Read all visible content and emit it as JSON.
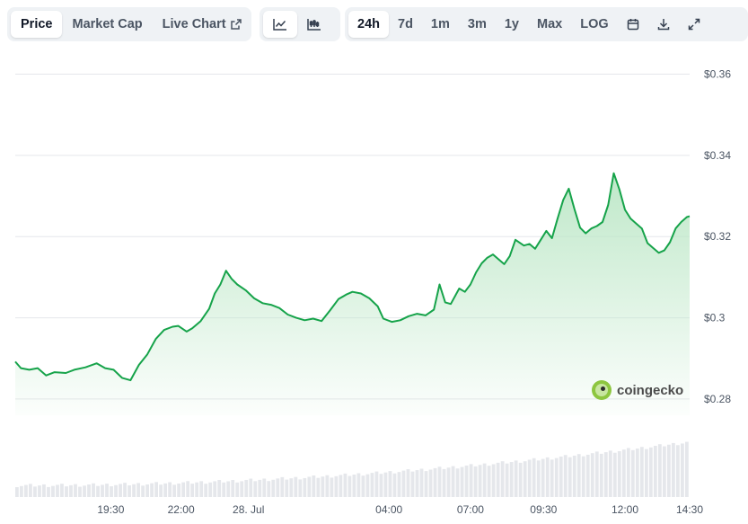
{
  "tabs": {
    "price": "Price",
    "market_cap": "Market Cap",
    "live_chart": "Live Chart"
  },
  "chart_types": [
    "line-chart-icon",
    "candlestick-icon"
  ],
  "ranges": [
    "24h",
    "7d",
    "1m",
    "3m",
    "1y",
    "Max",
    "LOG"
  ],
  "active_range": "24h",
  "active_tab": "Price",
  "tool_icons": [
    "calendar-icon",
    "download-icon",
    "expand-icon"
  ],
  "watermark": "coingecko",
  "colors": {
    "line": "#16a34a",
    "fill_top": "#c6ecd0",
    "volume": "#e5e7eb",
    "grid": "#e5e7eb",
    "logo": "#8dc63f"
  },
  "chart_data": {
    "type": "area",
    "title": "",
    "xlabel": "",
    "ylabel": "",
    "ylim": [
      0.276,
      0.361
    ],
    "yticks": [
      {
        "value": 0.36,
        "label": "$0.36"
      },
      {
        "value": 0.34,
        "label": "$0.34"
      },
      {
        "value": 0.32,
        "label": "$0.32"
      },
      {
        "value": 0.3,
        "label": "$0.3"
      },
      {
        "value": 0.28,
        "label": "$0.28"
      }
    ],
    "xrange": [
      0,
      24
    ],
    "xticks": [
      {
        "t": 3.4,
        "label": "19:30"
      },
      {
        "t": 5.9,
        "label": "22:00"
      },
      {
        "t": 8.3,
        "label": "28. Jul"
      },
      {
        "t": 13.3,
        "label": "04:00"
      },
      {
        "t": 16.2,
        "label": "07:00"
      },
      {
        "t": 18.8,
        "label": "09:30"
      },
      {
        "t": 21.7,
        "label": "12:00"
      },
      {
        "t": 24.0,
        "label": "14:30"
      }
    ],
    "series": [
      {
        "values": [
          [
            0.0,
            0.2892
          ],
          [
            0.2,
            0.2876
          ],
          [
            0.5,
            0.2872
          ],
          [
            0.8,
            0.2876
          ],
          [
            1.1,
            0.2858
          ],
          [
            1.4,
            0.2866
          ],
          [
            1.8,
            0.2864
          ],
          [
            2.1,
            0.2872
          ],
          [
            2.5,
            0.2878
          ],
          [
            2.9,
            0.2888
          ],
          [
            3.2,
            0.2876
          ],
          [
            3.5,
            0.2872
          ],
          [
            3.8,
            0.2852
          ],
          [
            4.1,
            0.2846
          ],
          [
            4.4,
            0.2884
          ],
          [
            4.7,
            0.291
          ],
          [
            5.0,
            0.2948
          ],
          [
            5.3,
            0.297
          ],
          [
            5.6,
            0.2978
          ],
          [
            5.8,
            0.298
          ],
          [
            6.1,
            0.2966
          ],
          [
            6.3,
            0.2974
          ],
          [
            6.6,
            0.2992
          ],
          [
            6.9,
            0.3022
          ],
          [
            7.1,
            0.306
          ],
          [
            7.3,
            0.3082
          ],
          [
            7.5,
            0.3116
          ],
          [
            7.7,
            0.3096
          ],
          [
            7.9,
            0.3082
          ],
          [
            8.2,
            0.3068
          ],
          [
            8.5,
            0.3048
          ],
          [
            8.8,
            0.3036
          ],
          [
            9.1,
            0.3032
          ],
          [
            9.4,
            0.3024
          ],
          [
            9.7,
            0.3008
          ],
          [
            10.0,
            0.3
          ],
          [
            10.3,
            0.2994
          ],
          [
            10.6,
            0.2998
          ],
          [
            10.9,
            0.2992
          ],
          [
            11.2,
            0.3018
          ],
          [
            11.5,
            0.3046
          ],
          [
            11.8,
            0.3058
          ],
          [
            12.0,
            0.3064
          ],
          [
            12.3,
            0.306
          ],
          [
            12.6,
            0.3048
          ],
          [
            12.9,
            0.3028
          ],
          [
            13.1,
            0.2998
          ],
          [
            13.4,
            0.299
          ],
          [
            13.7,
            0.2994
          ],
          [
            14.0,
            0.3004
          ],
          [
            14.3,
            0.301
          ],
          [
            14.6,
            0.3006
          ],
          [
            14.9,
            0.302
          ],
          [
            15.1,
            0.3082
          ],
          [
            15.3,
            0.3038
          ],
          [
            15.5,
            0.3034
          ],
          [
            15.8,
            0.3072
          ],
          [
            16.0,
            0.3064
          ],
          [
            16.2,
            0.3082
          ],
          [
            16.4,
            0.3112
          ],
          [
            16.6,
            0.3134
          ],
          [
            16.8,
            0.3148
          ],
          [
            17.0,
            0.3156
          ],
          [
            17.2,
            0.3144
          ],
          [
            17.4,
            0.3132
          ],
          [
            17.6,
            0.3152
          ],
          [
            17.8,
            0.3192
          ],
          [
            18.1,
            0.3178
          ],
          [
            18.3,
            0.3182
          ],
          [
            18.5,
            0.317
          ],
          [
            18.7,
            0.3192
          ],
          [
            18.9,
            0.3214
          ],
          [
            19.1,
            0.3196
          ],
          [
            19.3,
            0.3244
          ],
          [
            19.5,
            0.329
          ],
          [
            19.7,
            0.3318
          ],
          [
            19.9,
            0.3268
          ],
          [
            20.1,
            0.3222
          ],
          [
            20.3,
            0.3208
          ],
          [
            20.5,
            0.322
          ],
          [
            20.7,
            0.3226
          ],
          [
            20.9,
            0.3236
          ],
          [
            21.1,
            0.3278
          ],
          [
            21.3,
            0.3356
          ],
          [
            21.5,
            0.3316
          ],
          [
            21.7,
            0.3266
          ],
          [
            21.9,
            0.3244
          ],
          [
            22.1,
            0.3232
          ],
          [
            22.3,
            0.322
          ],
          [
            22.5,
            0.3184
          ],
          [
            22.7,
            0.3172
          ],
          [
            22.9,
            0.316
          ],
          [
            23.1,
            0.3166
          ],
          [
            23.3,
            0.3186
          ],
          [
            23.5,
            0.322
          ],
          [
            23.7,
            0.3236
          ],
          [
            23.9,
            0.3248
          ],
          [
            24.0,
            0.325
          ]
        ]
      }
    ]
  }
}
